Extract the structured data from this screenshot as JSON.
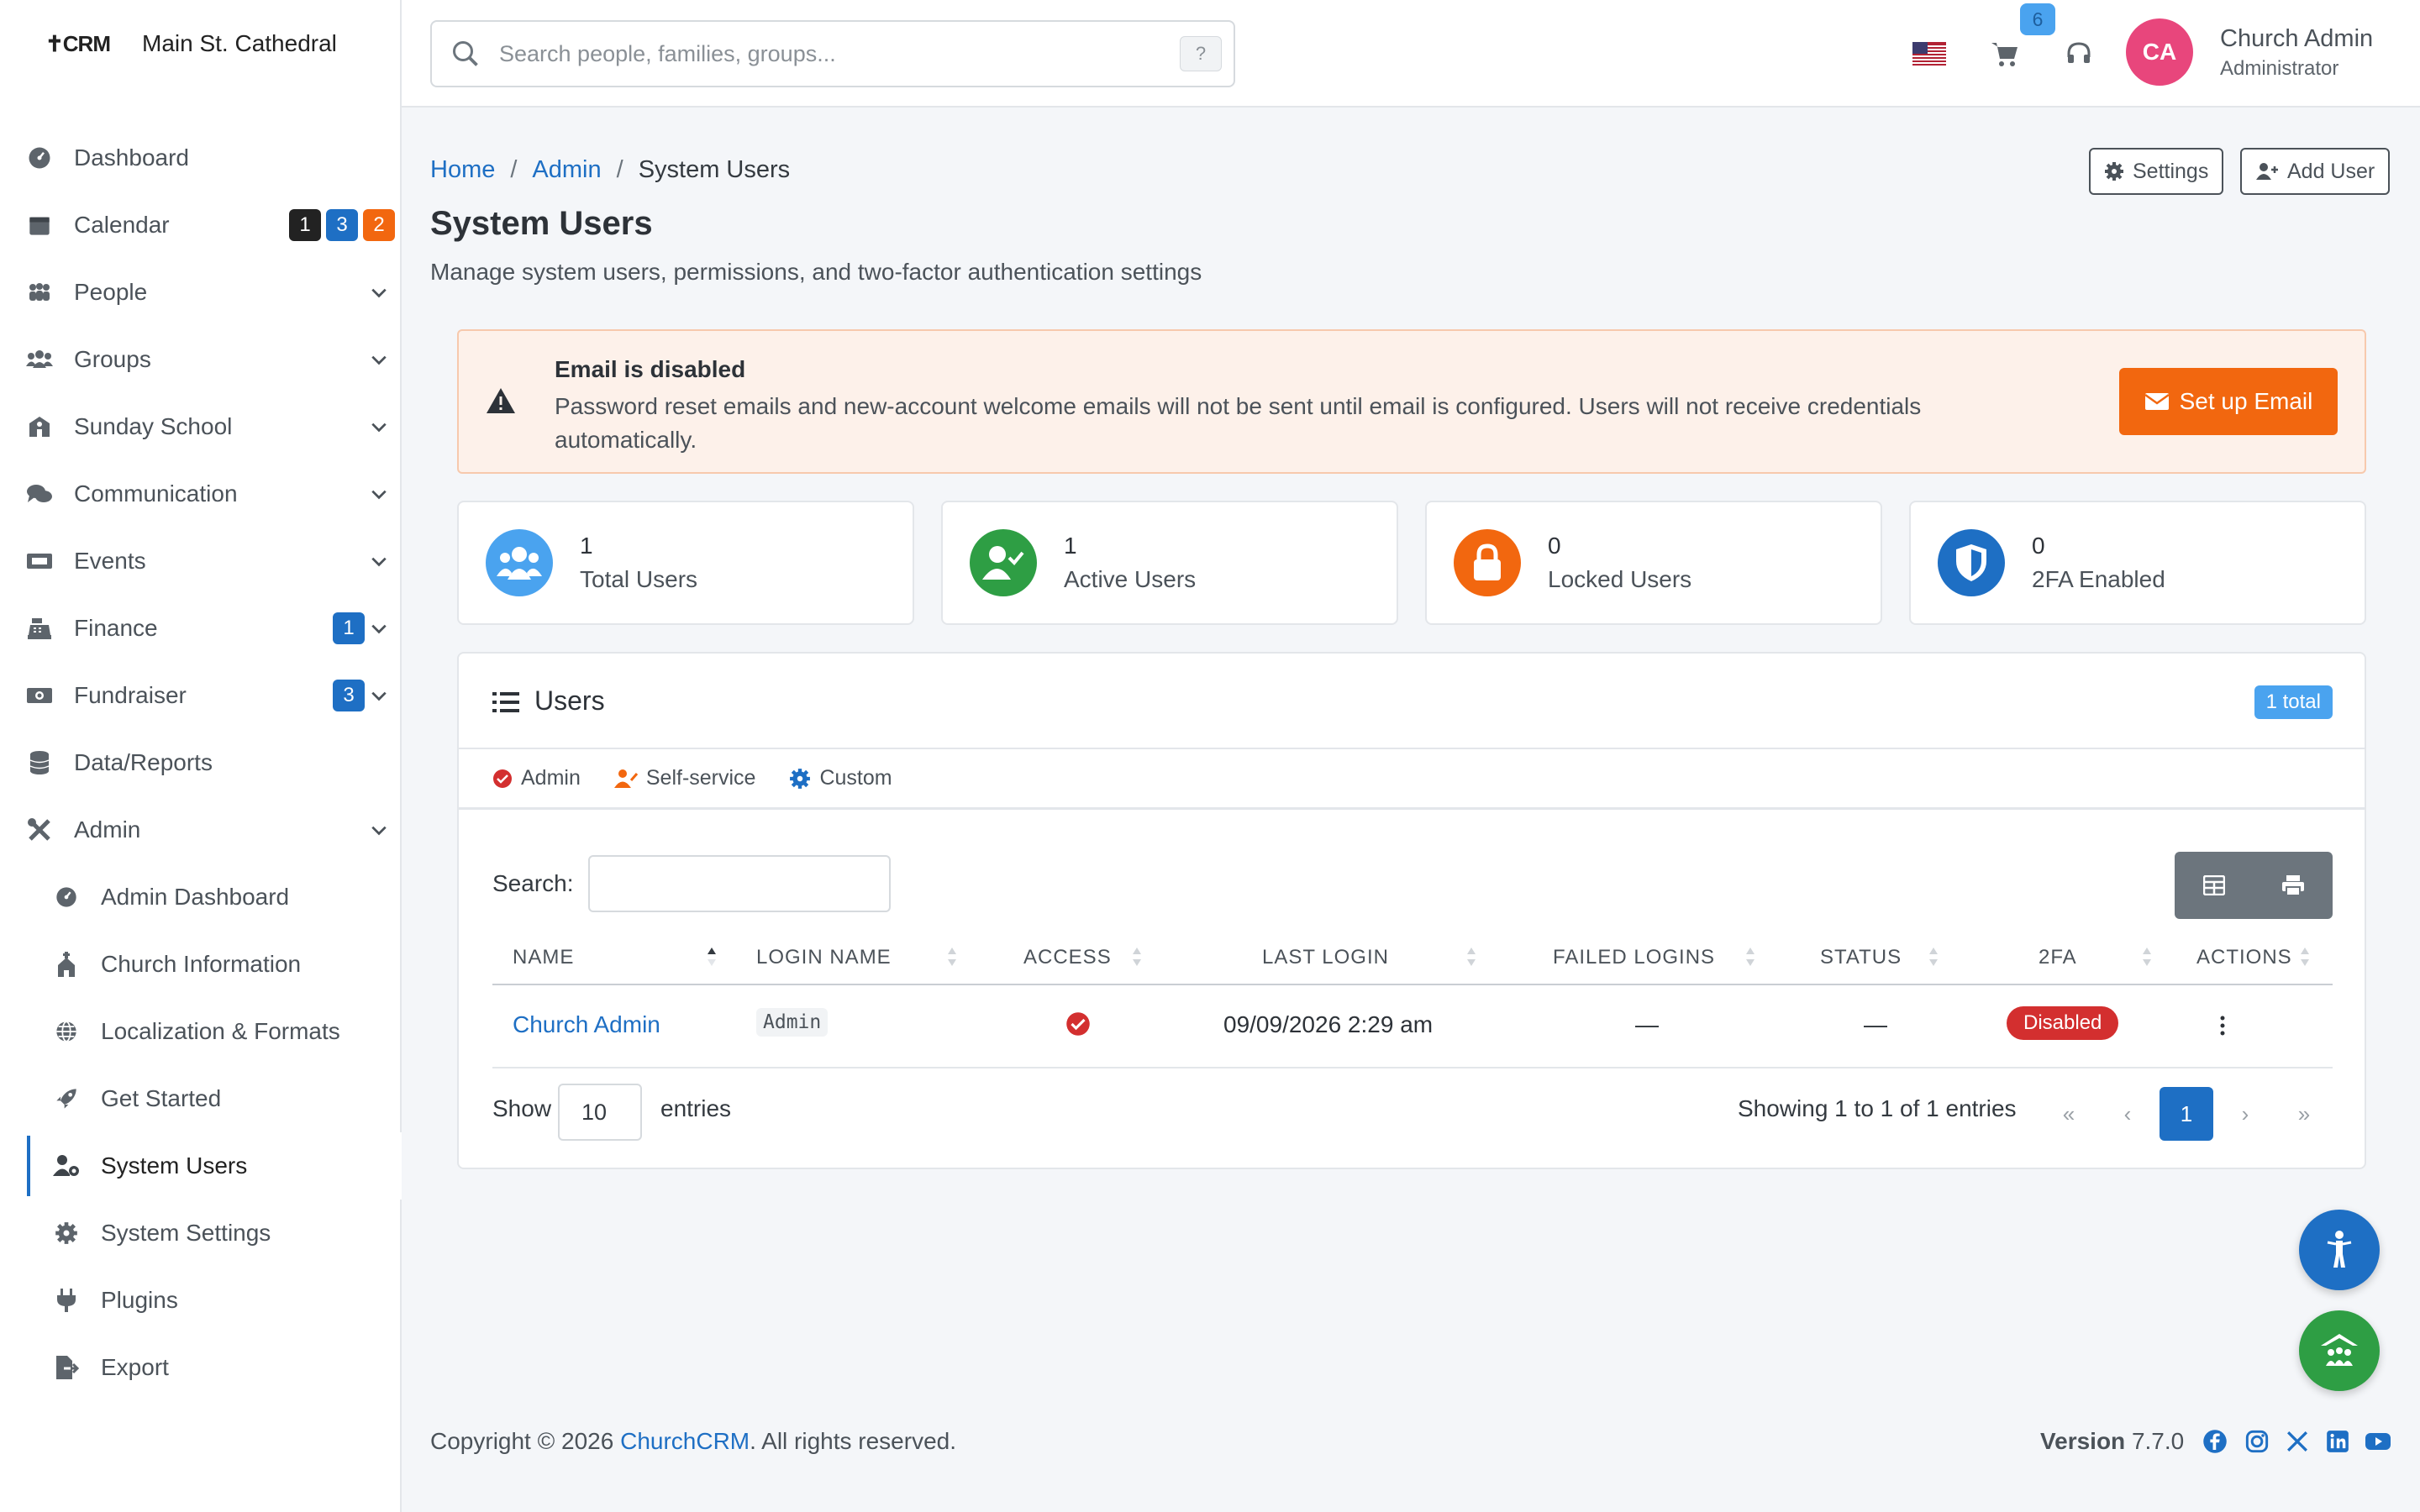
{
  "brand": {
    "logo": "✝CRM",
    "name": "Main St. Cathedral"
  },
  "sidebar": {
    "items": [
      {
        "label": "Dashboard"
      },
      {
        "label": "Calendar",
        "badges": [
          "1",
          "3",
          "2"
        ]
      },
      {
        "label": "People"
      },
      {
        "label": "Groups"
      },
      {
        "label": "Sunday School"
      },
      {
        "label": "Communication"
      },
      {
        "label": "Events"
      },
      {
        "label": "Finance",
        "badge": "1"
      },
      {
        "label": "Fundraiser",
        "badge": "3"
      },
      {
        "label": "Data/Reports"
      },
      {
        "label": "Admin"
      }
    ],
    "admin_sub": [
      {
        "label": "Admin Dashboard"
      },
      {
        "label": "Church Information"
      },
      {
        "label": "Localization & Formats"
      },
      {
        "label": "Get Started"
      },
      {
        "label": "System Users"
      },
      {
        "label": "System Settings"
      },
      {
        "label": "Plugins"
      },
      {
        "label": "Export"
      }
    ]
  },
  "topbar": {
    "search_placeholder": "Search people, families, groups...",
    "search_kbd": "?",
    "cart_count": "6",
    "user_initials": "CA",
    "user_name": "Church Admin",
    "user_role": "Administrator"
  },
  "breadcrumb": {
    "home": "Home",
    "sep": "/",
    "admin": "Admin",
    "current": "System Users"
  },
  "page": {
    "title": "System Users",
    "subtitle": "Manage system users, permissions, and two-factor authentication settings",
    "settings_btn": "Settings",
    "add_user_btn": "Add User"
  },
  "alert": {
    "title": "Email is disabled",
    "text": "Password reset emails and new-account welcome emails will not be sent until email is configured. Users will not receive credentials automatically.",
    "button": "Set up Email"
  },
  "stats": [
    {
      "value": "1",
      "label": "Total Users"
    },
    {
      "value": "1",
      "label": "Active Users"
    },
    {
      "value": "0",
      "label": "Locked Users"
    },
    {
      "value": "0",
      "label": "2FA Enabled"
    }
  ],
  "users_card": {
    "title": "Users",
    "total_badge": "1 total",
    "legend": [
      "Admin",
      "Self-service",
      "Custom"
    ],
    "search_label": "Search:",
    "columns": [
      "NAME",
      "LOGIN NAME",
      "ACCESS",
      "LAST LOGIN",
      "FAILED LOGINS",
      "STATUS",
      "2FA",
      "ACTIONS"
    ],
    "rows": [
      {
        "name": "Church Admin",
        "login": "Admin",
        "last_login": "09/09/2026 2:29 am",
        "failed": "—",
        "status": "—",
        "twofa": "Disabled"
      }
    ],
    "show_label": "Show",
    "show_value": "10",
    "entries_label": "entries",
    "showing": "Showing 1 to 1 of 1 entries",
    "pages": [
      "«",
      "‹",
      "1",
      "›",
      "»"
    ]
  },
  "footer": {
    "copyright_pre": "Copyright © 2026 ",
    "link": "ChurchCRM",
    "copyright_post": ". All rights reserved.",
    "version_label": "Version",
    "version": "7.7.0"
  },
  "colors": {
    "accent": "#1e6fc4",
    "orange": "#f2670f",
    "danger": "#d32f2f",
    "success": "#2e9e44"
  }
}
